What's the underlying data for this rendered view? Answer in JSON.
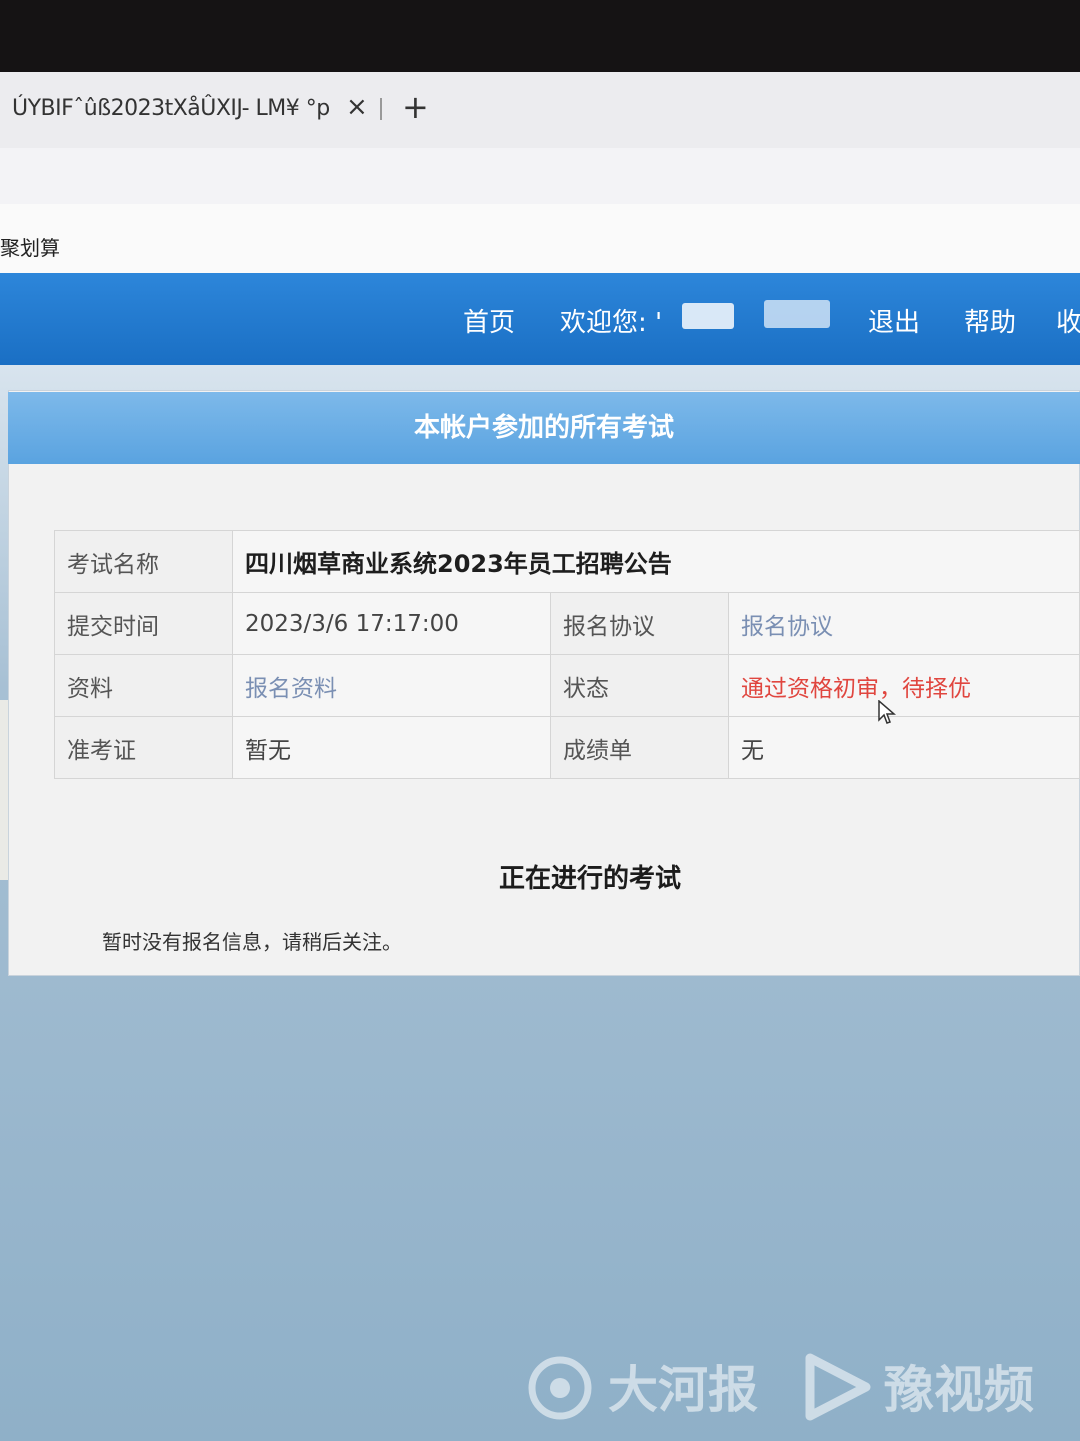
{
  "browser": {
    "tab_title": "ÚYBIFˆûß2023tXåÛXIJ- LM¥ °p",
    "tab_close": "×",
    "tab_new": "+",
    "bookmark_label": "聚划算"
  },
  "nav": {
    "home": "首页",
    "welcome": "欢迎您: '",
    "logout": "退出",
    "help": "帮助",
    "more": "收"
  },
  "panel": {
    "header": "本帐户参加的所有考试",
    "rows": {
      "exam_name_label": "考试名称",
      "exam_name_value": "四川烟草商业系统2023年员工招聘公告",
      "submit_time_label": "提交时间",
      "submit_time_value": "2023/3/6 17:17:00",
      "agreement_label": "报名协议",
      "agreement_link": "报名协议",
      "materials_label": "资料",
      "materials_link": "报名资料",
      "status_label": "状态",
      "status_value": "通过资格初审，待择优",
      "admission_label": "准考证",
      "admission_value": "暂无",
      "score_label": "成绩单",
      "score_value": "无"
    },
    "ongoing_title": "正在进行的考试",
    "ongoing_notice": "暂时没有报名信息，请稍后关注。"
  },
  "watermark": {
    "left": "大河报",
    "right": "豫视频"
  },
  "colors": {
    "navbar": "#1a6fc4",
    "header": "#5aa3e0",
    "status": "#e0463f",
    "link": "#7a8fb3"
  }
}
